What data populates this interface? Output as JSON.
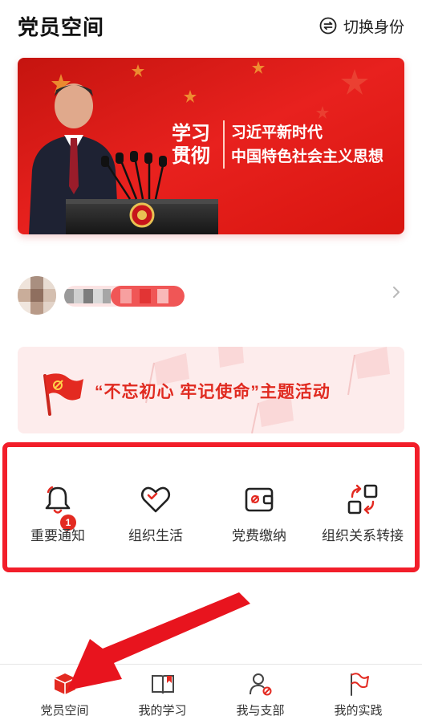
{
  "header": {
    "title": "党员空间",
    "switch_label": "切换身份",
    "switch_icon": "swap-icon"
  },
  "banner": {
    "title_line1": "学习",
    "title_line2": "贯彻",
    "subtitle_line1": "习近平新时代",
    "subtitle_line2": "中国特色社会主义思想",
    "color": "#e8211e"
  },
  "activity": {
    "title": "“不忘初心 牢记使命”主题活动",
    "icon": "party-flag-icon"
  },
  "functions": [
    {
      "label": "重要通知",
      "icon": "bell-icon",
      "badge": "1"
    },
    {
      "label": "组织生活",
      "icon": "heart-icon"
    },
    {
      "label": "党费缴纳",
      "icon": "wallet-icon"
    },
    {
      "label": "组织关系转接",
      "icon": "transfer-icon"
    }
  ],
  "tabs": [
    {
      "label": "党员空间",
      "icon": "cube-icon",
      "active": true
    },
    {
      "label": "我的学习",
      "icon": "book-icon"
    },
    {
      "label": "我与支部",
      "icon": "member-icon"
    },
    {
      "label": "我的实践",
      "icon": "flag-icon"
    }
  ],
  "colors": {
    "accent": "#e32a21",
    "highlight_box": "#f21e2a",
    "annotation_arrow": "#e8141e"
  }
}
